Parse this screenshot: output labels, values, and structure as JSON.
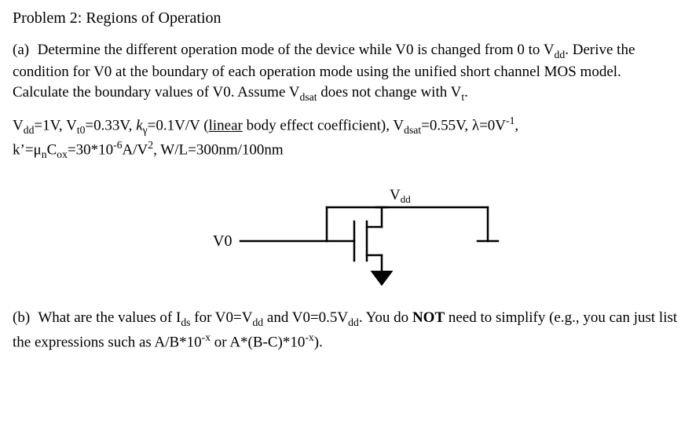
{
  "title": "Problem 2: Regions of Operation",
  "partA": {
    "label": "(a)",
    "p1a": "Determine the different operation mode of the device while V0 is changed from 0 to V",
    "p1b": ". Derive the condition for V0 at the boundary of each operation mode using the unified short channel MOS model. Calculate the boundary values of V0. Assume V",
    "p1c": " does not change with V",
    "p1d": "."
  },
  "params": {
    "vdd_label": "V",
    "vdd_sub": "dd",
    "vdd_val": "=1V, ",
    "vt0_label": "V",
    "vt0_sub": "t0",
    "vt0_val": "=0.33V, ",
    "kg_label": "k",
    "kg_sub": "γ",
    "kg_val": "=0.1V/V (",
    "linear_word": "linear",
    "kg_after": " body effect coefficient), ",
    "vdsat_label": "V",
    "vdsat_sub": "dsat",
    "vdsat_val": "=0.55V, λ=0V",
    "lambda_sup": "-1",
    "lambda_after": ",",
    "kprime": "k’=μ",
    "kprime_subn": "n",
    "kprime_c": "C",
    "kprime_subox": "ox",
    "kprime_val": "=30*10",
    "kprime_sup": "-6",
    "kprime_unit": "A/V",
    "kprime_sup2": "2",
    "wl": ", W/L=300nm/100nm"
  },
  "figure": {
    "v0": "V0",
    "vdd": "Vdd"
  },
  "partB": {
    "label": "(b)",
    "t1": "What are the values of I",
    "ids_sub": "ds",
    "t2": " for V0=V",
    "t3": " and V0=0.5V",
    "t4": ". You do ",
    "not": "NOT",
    "t5": " need to simplify (e.g., you can just list the expressions such as A/B*10",
    "expX": "-x",
    "t6": " or A*(B-C)*10",
    "t7": ")."
  }
}
